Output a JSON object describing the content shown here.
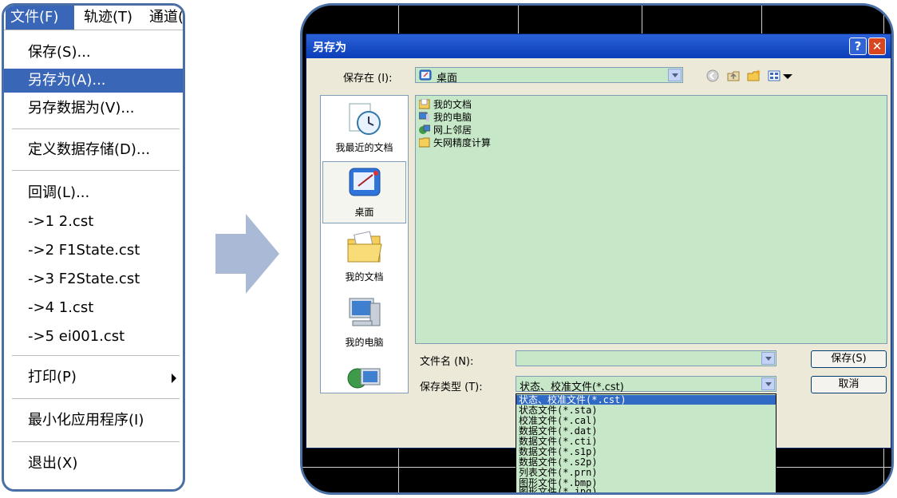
{
  "menu": {
    "bar": [
      "文件(F)",
      "轨迹(T)",
      "通道("
    ],
    "items": [
      {
        "label": "保存(S)..."
      },
      {
        "label": "另存为(A)..."
      },
      {
        "label": "另存数据为(V)..."
      },
      {
        "label": "定义数据存储(D)..."
      },
      {
        "label": "回调(L)..."
      },
      {
        "label": "->1 2.cst"
      },
      {
        "label": "->2 F1State.cst"
      },
      {
        "label": "->3 F2State.cst"
      },
      {
        "label": "->4 1.cst"
      },
      {
        "label": "->5 ei001.cst"
      },
      {
        "label": "打印(P)"
      },
      {
        "label": "最小化应用程序(I)"
      },
      {
        "label": "退出(X)"
      }
    ]
  },
  "dialog": {
    "title": "另存为",
    "help_glyph": "?",
    "close_glyph": "✕",
    "save_in_label": "保存在 (I):",
    "save_in_value": "桌面",
    "places": [
      "我最近的文档",
      "桌面",
      "我的文档",
      "我的电脑"
    ],
    "files": [
      "我的文档",
      "我的电脑",
      "网上邻居",
      "矢网精度计算"
    ],
    "filename_label": "文件名 (N):",
    "filename_value": "",
    "filetype_label": "保存类型 (T):",
    "filetype_value": "状态、校准文件(*.cst)",
    "save_button": "保存(S)",
    "cancel_button": "取消",
    "filetype_options": [
      "状态、校准文件(*.cst)",
      "状态文件(*.sta)",
      "校准文件(*.cal)",
      "数据文件(*.dat)",
      "数据文件(*.cti)",
      "数据文件(*.s1p)",
      "数据文件(*.s2p)",
      "列表文件(*.prn)",
      "图形文件(*.bmp)",
      "图形文件(*.jpg)"
    ]
  },
  "colors": {
    "menu_highlight": "#3a66b8",
    "panel_border": "#4a6fa5",
    "dialog_field_bg": "#c6e8c8",
    "titlebar": "#0b3eb8"
  }
}
